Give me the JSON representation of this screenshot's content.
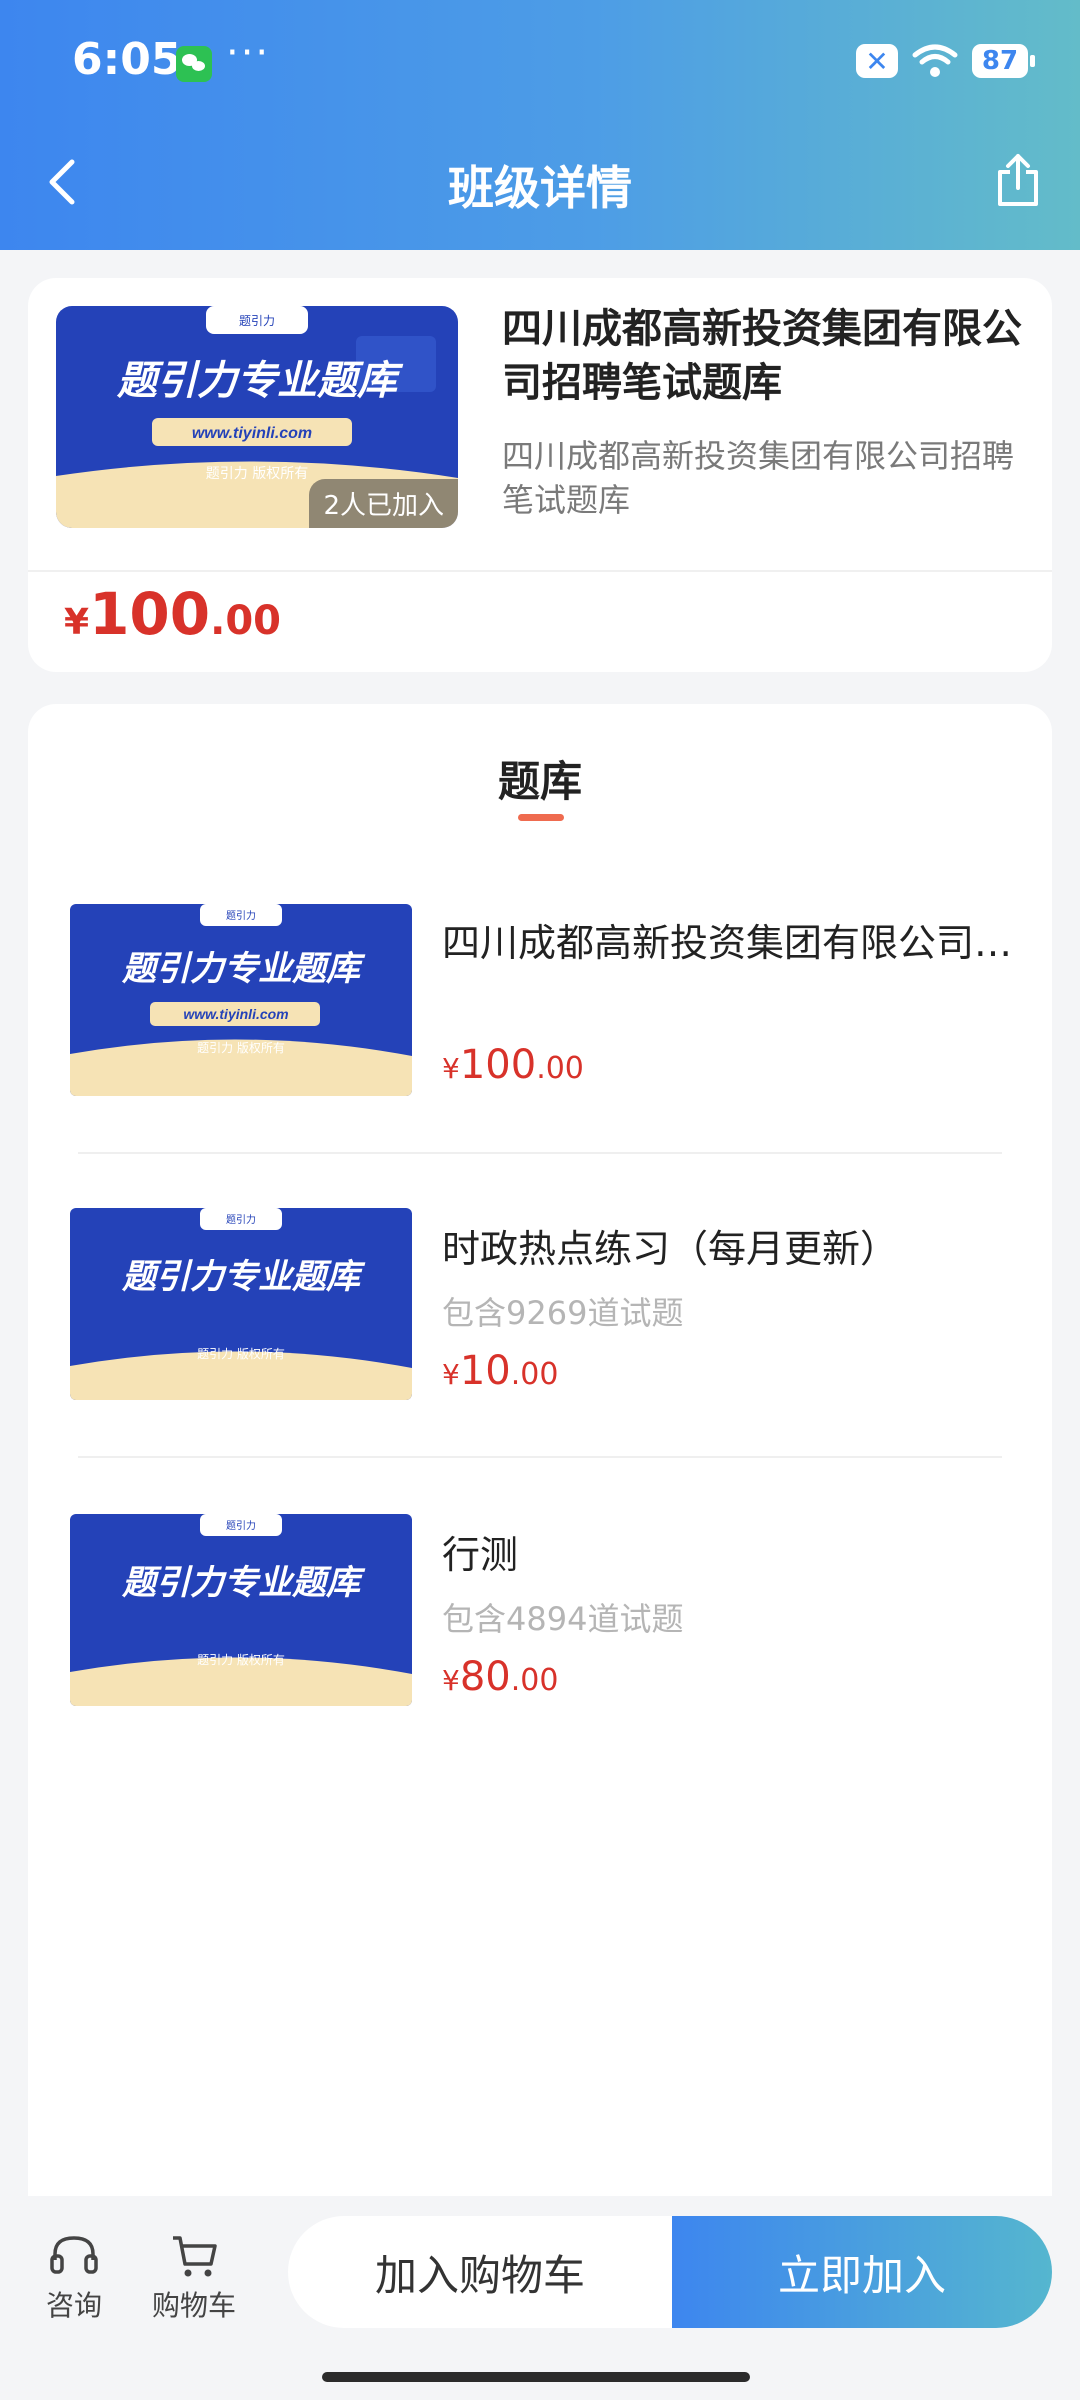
{
  "status_bar": {
    "time": "6:05",
    "more": "···",
    "battery": "87"
  },
  "header": {
    "title": "班级详情"
  },
  "course": {
    "cover": {
      "brand": "题引力",
      "headline": "题引力专业题库",
      "url": "www.tiyinli.com",
      "copyright": "题引力 版权所有"
    },
    "join_count": "2人已加入",
    "title": "四川成都高新投资集团有限公司招聘笔试题库",
    "subtitle": "四川成都高新投资集团有限公司招聘笔试题库",
    "price": {
      "currency": "¥",
      "integer": "100",
      "decimal": ".00"
    }
  },
  "section": {
    "title": "题库"
  },
  "banks": [
    {
      "title": "四川成都高新投资集团有限公司招聘笔试题库",
      "count": "",
      "price": {
        "currency": "¥",
        "integer": "100",
        "decimal": ".00"
      },
      "cover": {
        "brand": "题引力",
        "headline": "题引力专业题库",
        "url": "www.tiyinli.com",
        "copyright": "题引力 版权所有"
      }
    },
    {
      "title": "时政热点练习（每月更新）",
      "count": "包含9269道试题",
      "price": {
        "currency": "¥",
        "integer": "10",
        "decimal": ".00"
      },
      "cover": {
        "brand": "题引力",
        "headline": "题引力专业题库",
        "url": "",
        "copyright": "题引力 版权所有"
      }
    },
    {
      "title": "行测",
      "count": "包含4894道试题",
      "price": {
        "currency": "¥",
        "integer": "80",
        "decimal": ".00"
      },
      "cover": {
        "brand": "题引力",
        "headline": "题引力专业题库",
        "url": "",
        "copyright": "题引力 版权所有"
      }
    }
  ],
  "bottom_bar": {
    "consult_label": "咨询",
    "cart_label": "购物车",
    "add_cart_button": "加入购物车",
    "join_button": "立即加入"
  },
  "colors": {
    "header_start": "#3d86ef",
    "header_end": "#63bcc9",
    "price": "#d8322a",
    "accent_underline": "#ef6b4f"
  }
}
